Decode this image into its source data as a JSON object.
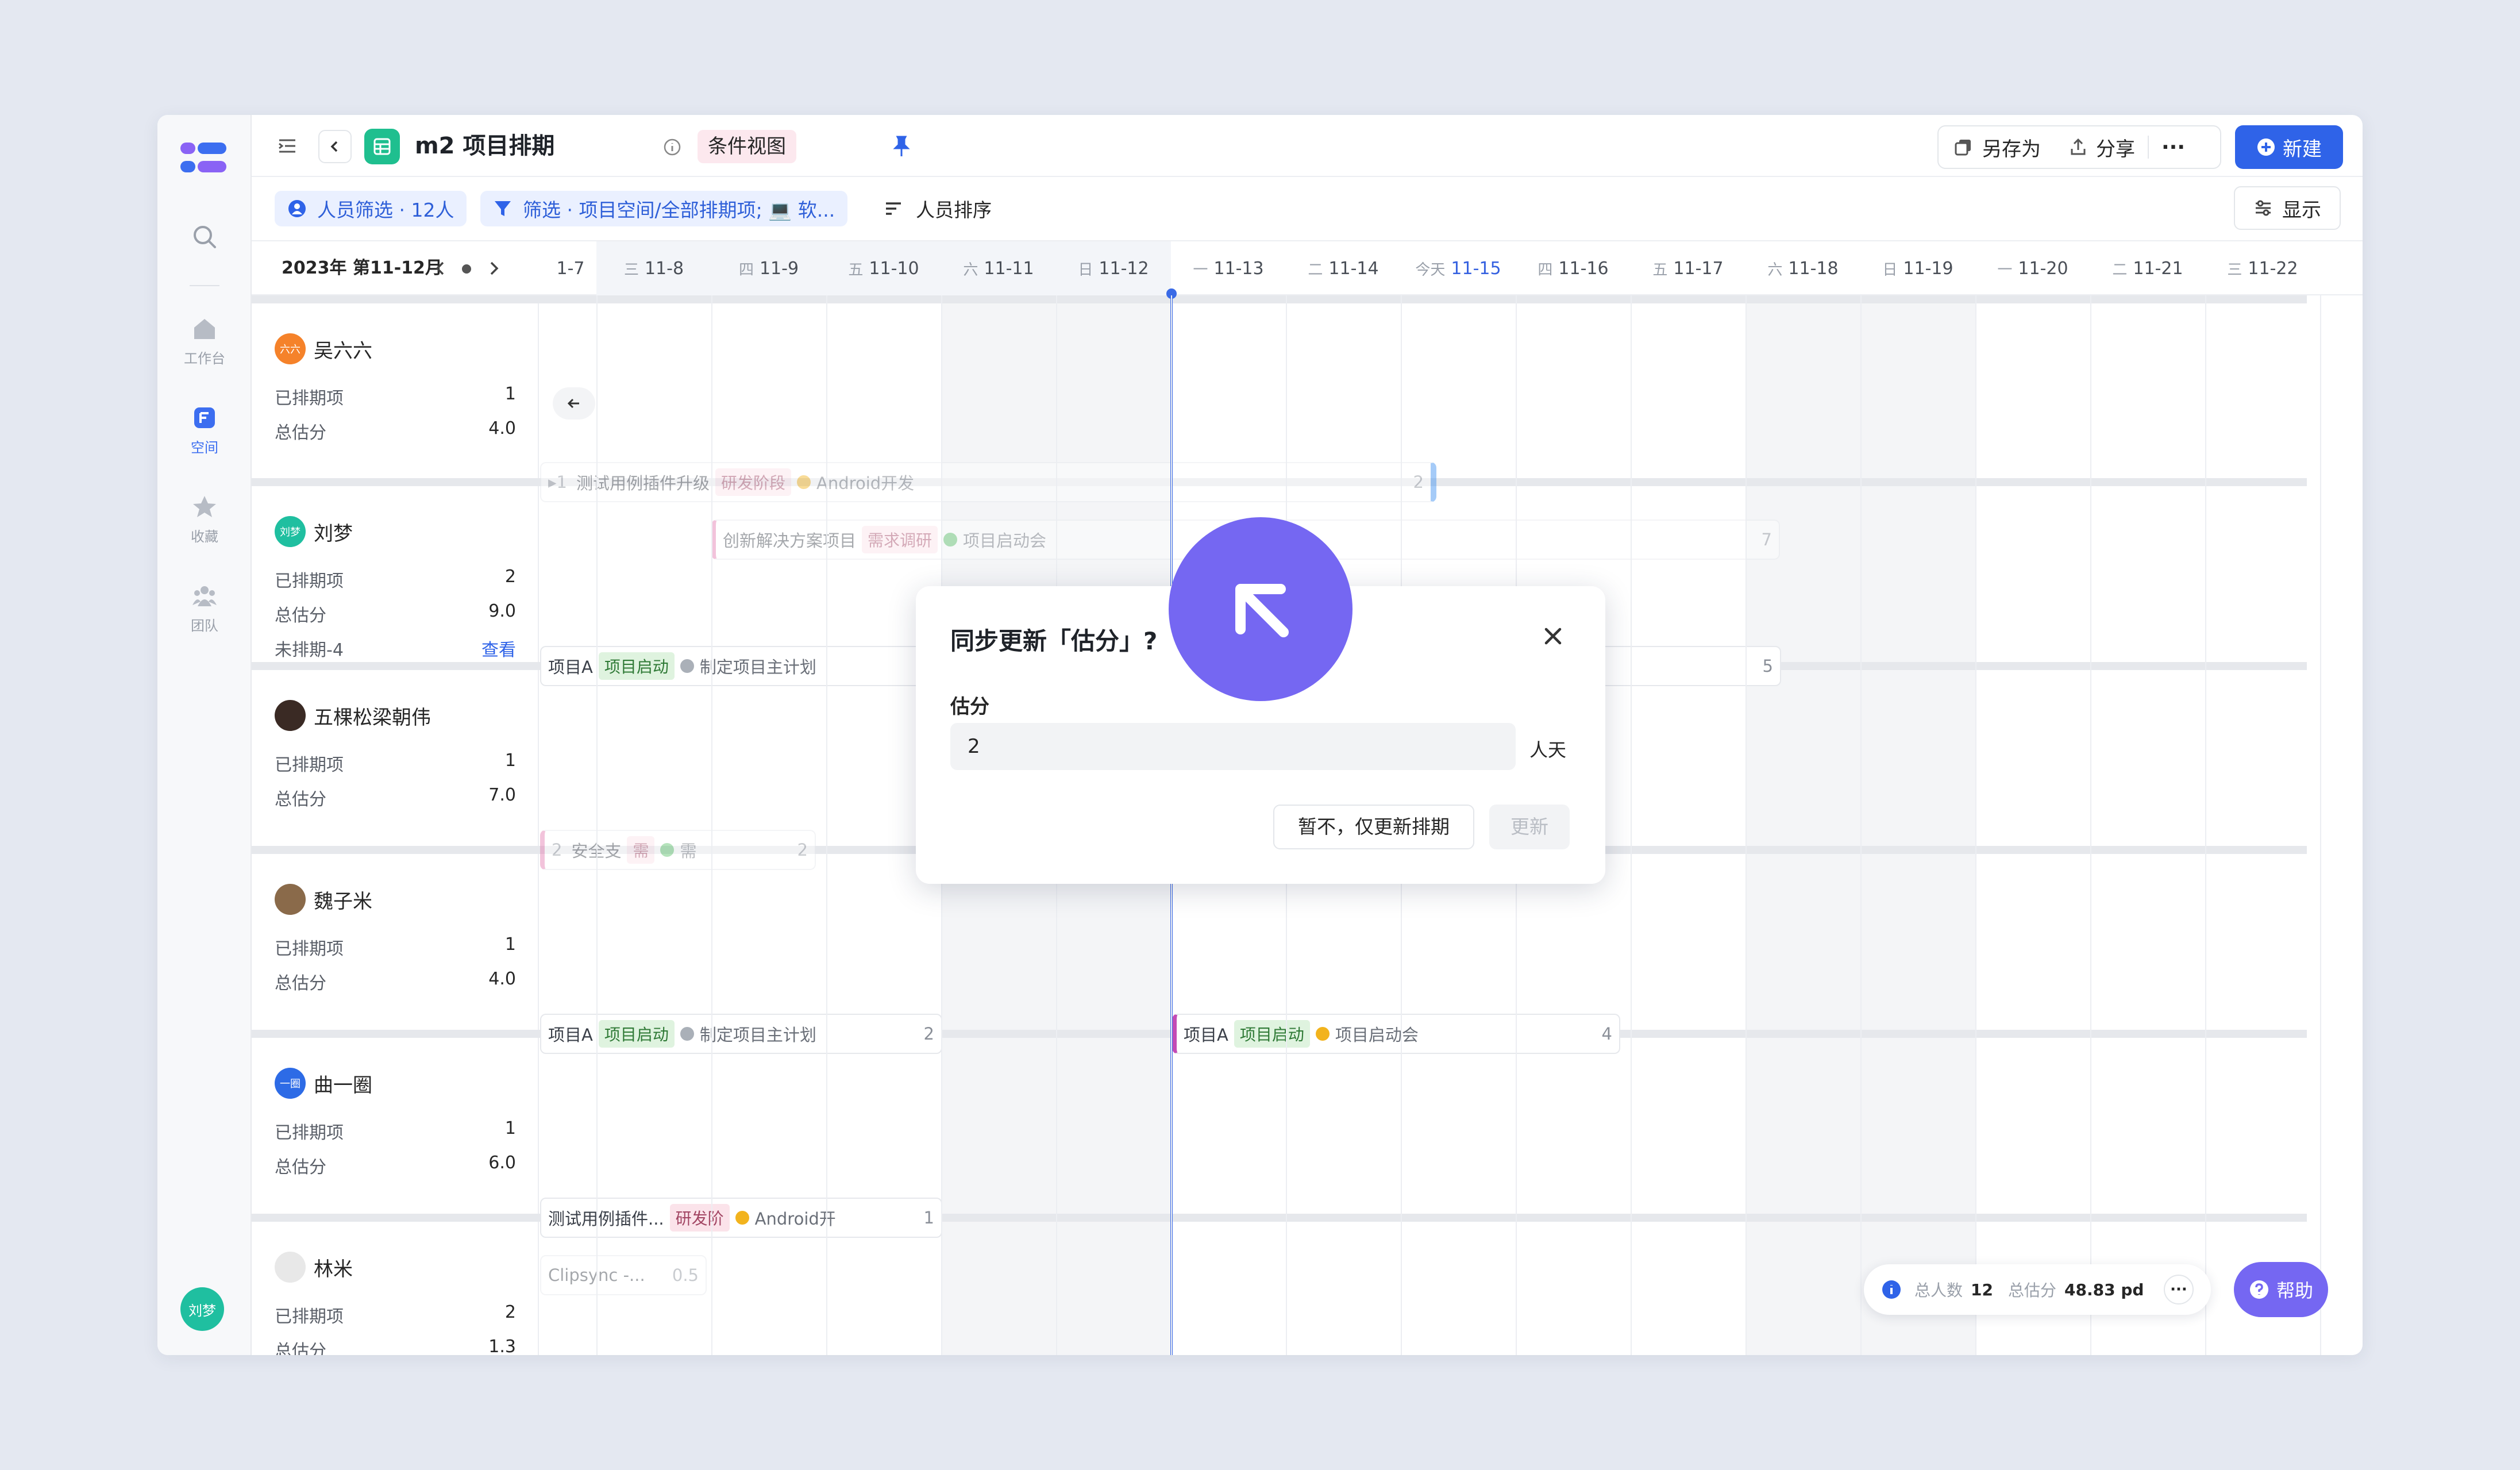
{
  "rail": {
    "items": [
      {
        "label": ""
      },
      {
        "label": "工作台"
      },
      {
        "label": "空间"
      },
      {
        "label": "收藏"
      },
      {
        "label": "团队"
      }
    ],
    "user_avatar": "刘梦"
  },
  "toolbar": {
    "title": "m2 项目排期",
    "view_badge": "条件视图",
    "save_as": "另存为",
    "share": "分享",
    "more": "···",
    "new": "新建"
  },
  "filters": {
    "people": "人员筛选 · 12人",
    "scope": "筛选 · 项目空间/全部排期项; 💻 软...",
    "sort": "人员排序",
    "display": "显示"
  },
  "calendar": {
    "month": "2023年 第11-12月",
    "dates": [
      {
        "w": "",
        "d": "1-7"
      },
      {
        "w": "三",
        "d": "11-8"
      },
      {
        "w": "四",
        "d": "11-9"
      },
      {
        "w": "五",
        "d": "11-10"
      },
      {
        "w": "六",
        "d": "11-11"
      },
      {
        "w": "日",
        "d": "11-12"
      },
      {
        "w": "一",
        "d": "11-13"
      },
      {
        "w": "二",
        "d": "11-14"
      },
      {
        "w": "今天",
        "d": "11-15"
      },
      {
        "w": "四",
        "d": "11-16"
      },
      {
        "w": "五",
        "d": "11-17"
      },
      {
        "w": "六",
        "d": "11-18"
      },
      {
        "w": "日",
        "d": "11-19"
      },
      {
        "w": "一",
        "d": "11-20"
      },
      {
        "w": "二",
        "d": "11-21"
      },
      {
        "w": "三",
        "d": "11-22"
      },
      {
        "w": "四",
        "d": ""
      }
    ]
  },
  "people": [
    {
      "name": "吴六六",
      "avatar": "六六",
      "color": "#f5822a",
      "stats": [
        [
          "已排期项",
          "1"
        ],
        [
          "总估分",
          "4.0"
        ]
      ]
    },
    {
      "name": "刘梦",
      "avatar": "刘梦",
      "color": "#1fbfa0",
      "stats": [
        [
          "已排期项",
          "2"
        ],
        [
          "总估分",
          "9.0"
        ],
        [
          "未排期-4",
          "查看"
        ]
      ]
    },
    {
      "name": "五棵松梁朝伟",
      "avatar": "",
      "color": "#3a2a24",
      "stats": [
        [
          "已排期项",
          "1"
        ],
        [
          "总估分",
          "7.0"
        ]
      ]
    },
    {
      "name": "魏子米",
      "avatar": "",
      "color": "#8a6a4a",
      "stats": [
        [
          "已排期项",
          "1"
        ],
        [
          "总估分",
          "4.0"
        ]
      ]
    },
    {
      "name": "曲一圈",
      "avatar": "一圈",
      "color": "#2d6be6",
      "stats": [
        [
          "已排期项",
          "1"
        ],
        [
          "总估分",
          "6.0"
        ]
      ]
    },
    {
      "name": "林米",
      "avatar": "",
      "color": "#e8e8e8",
      "stats": [
        [
          "已排期项",
          "2"
        ],
        [
          "总估分",
          "1.3"
        ]
      ]
    }
  ],
  "bars": {
    "b1": {
      "pre": "▸1",
      "text": "测试用例插件升级",
      "tag": "研发阶段",
      "label": "Android开发",
      "n": "2"
    },
    "b2": {
      "text": "创新解决方案项目",
      "tag": "需求调研",
      "label": "项目启动会",
      "n": "7"
    },
    "b3": {
      "text": "项目A",
      "tag": "项目启动",
      "label": "制定项目主计划",
      "n": "5"
    },
    "b4": {
      "pre": "2",
      "text": "安全支",
      "tag": "需",
      "label": "需",
      "n": "2"
    },
    "b5": {
      "text": "项目A",
      "tag": "项目启动",
      "label": "制定项目主计划",
      "n": "2"
    },
    "b6": {
      "text": "项目A",
      "tag": "项目启动",
      "label": "项目启动会",
      "n": "4"
    },
    "b7": {
      "text": "测试用例插件...",
      "tag": "研发阶",
      "label": "Android开",
      "n": "1"
    },
    "b8": {
      "text": "Clipsync -...",
      "n": "0.5"
    }
  },
  "dialog": {
    "title": "同步更新「估分」?",
    "field_label": "估分",
    "value": "2",
    "unit": "人天",
    "skip": "暂不，仅更新排期",
    "update": "更新"
  },
  "summary": {
    "people_label": "总人数",
    "people": "12",
    "score_label": "总估分",
    "score": "48.83 pd",
    "more": "···"
  },
  "help": "帮助",
  "colors": {
    "accent": "#2f63e8",
    "cursor": "#7567f2"
  }
}
